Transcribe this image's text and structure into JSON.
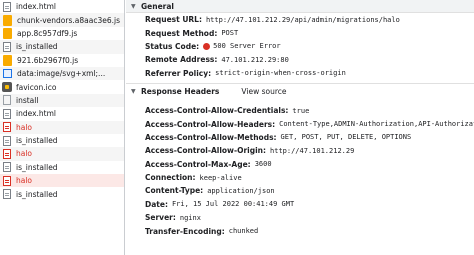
{
  "requests": [
    {
      "name": "index.html",
      "icon": "document-icon",
      "state": "normal"
    },
    {
      "name": "chunk-vendors.a8aac3e6.js",
      "icon": "script-icon",
      "state": "normal"
    },
    {
      "name": "app.8c957df9.js",
      "icon": "script-icon",
      "state": "normal"
    },
    {
      "name": "is_installed",
      "icon": "document-icon",
      "state": "normal"
    },
    {
      "name": "921.6b2967f0.js",
      "icon": "script-icon",
      "state": "normal"
    },
    {
      "name": "data:image/svg+xml;...",
      "icon": "image-icon",
      "state": "normal"
    },
    {
      "name": "favicon.ico",
      "icon": "favicon-icon",
      "state": "normal"
    },
    {
      "name": "install",
      "icon": "document-icon",
      "state": "normal"
    },
    {
      "name": "index.html",
      "icon": "document-icon",
      "state": "normal"
    },
    {
      "name": "halo",
      "icon": "document-icon",
      "state": "error"
    },
    {
      "name": "is_installed",
      "icon": "document-icon",
      "state": "normal"
    },
    {
      "name": "halo",
      "icon": "document-icon",
      "state": "error"
    },
    {
      "name": "is_installed",
      "icon": "document-icon",
      "state": "normal"
    },
    {
      "name": "halo",
      "icon": "document-icon",
      "state": "selected"
    },
    {
      "name": "is_installed",
      "icon": "document-icon",
      "state": "normal"
    }
  ],
  "general": {
    "title": "General",
    "request_url_label": "Request URL:",
    "request_url": "http://47.101.212.29/api/admin/migrations/halo",
    "request_method_label": "Request Method:",
    "request_method": "POST",
    "status_code_label": "Status Code:",
    "status_code": "500 Server Error",
    "remote_address_label": "Remote Address:",
    "remote_address": "47.101.212.29:80",
    "referrer_policy_label": "Referrer Policy:",
    "referrer_policy": "strict-origin-when-cross-origin"
  },
  "response_headers": {
    "title": "Response Headers",
    "view_source": "View source",
    "rows": [
      {
        "name": "Access-Control-Allow-Credentials:",
        "value": "true"
      },
      {
        "name": "Access-Control-Allow-Headers:",
        "value": "Content-Type,ADMIN-Authorization,API-Authorization"
      },
      {
        "name": "Access-Control-Allow-Methods:",
        "value": "GET, POST, PUT, DELETE, OPTIONS"
      },
      {
        "name": "Access-Control-Allow-Origin:",
        "value": "http://47.101.212.29"
      },
      {
        "name": "Access-Control-Max-Age:",
        "value": "3600"
      },
      {
        "name": "Connection:",
        "value": "keep-alive"
      },
      {
        "name": "Content-Type:",
        "value": "application/json"
      },
      {
        "name": "Date:",
        "value": "Fri, 15 Jul 2022 00:41:49 GMT"
      },
      {
        "name": "Server:",
        "value": "nginx"
      },
      {
        "name": "Transfer-Encoding:",
        "value": "chunked"
      }
    ]
  },
  "colors": {
    "error": "#d93025",
    "selected_bg": "#fce8e6",
    "section_bg": "#f1f3f4"
  }
}
